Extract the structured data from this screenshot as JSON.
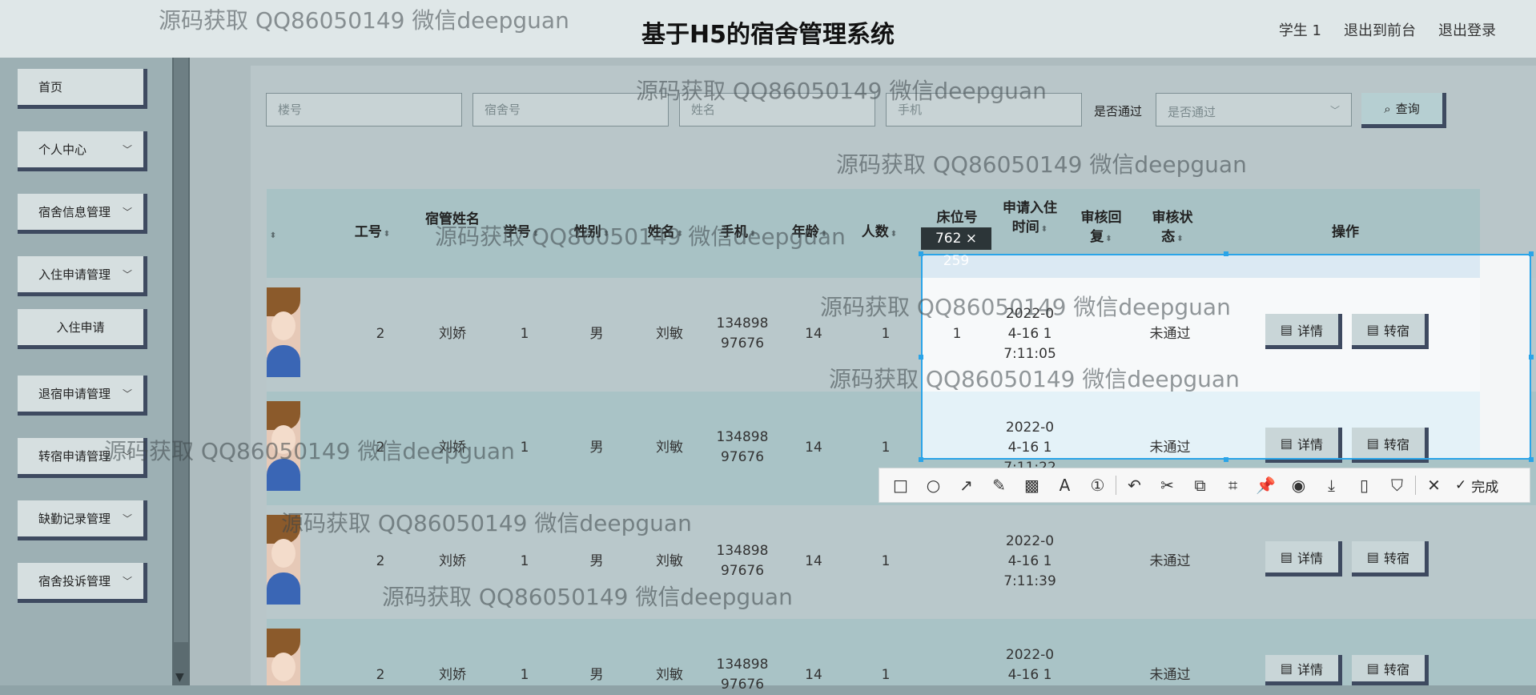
{
  "header": {
    "title": "基于H5的宿舍管理系统",
    "links": [
      "学生 1",
      "退出到前台",
      "退出登录"
    ]
  },
  "sidebar": {
    "items": [
      {
        "label": "首页",
        "has_chevron": false
      },
      {
        "label": "个人中心",
        "has_chevron": true
      },
      {
        "label": "宿舍信息管理",
        "has_chevron": true
      },
      {
        "label": "入住申请管理",
        "has_chevron": true
      },
      {
        "label": "入住申请",
        "has_chevron": false
      },
      {
        "label": "退宿申请管理",
        "has_chevron": true
      },
      {
        "label": "转宿申请管理",
        "has_chevron": true
      },
      {
        "label": "缺勤记录管理",
        "has_chevron": true
      },
      {
        "label": "宿舍投诉管理",
        "has_chevron": true
      }
    ]
  },
  "search": {
    "building_placeholder": "楼号",
    "room_placeholder": "宿舍号",
    "name_placeholder": "姓名",
    "phone_placeholder": "手机",
    "pass_label": "是否通过",
    "pass_placeholder": "是否通过",
    "query_label": "查询"
  },
  "table": {
    "columns": {
      "job_no": "工号",
      "manager_name": "宿管姓名",
      "student_no": "学号",
      "gender": "性别",
      "name": "姓名",
      "phone": "手机",
      "age": "年龄",
      "count": "人数",
      "bed_no": "床位号",
      "apply_time": "申请入住时间",
      "reply": "审核回复",
      "status": "审核状态",
      "actions": "操作"
    },
    "rows": [
      {
        "job_no": "2",
        "manager": "刘娇",
        "student_no": "1",
        "gender": "男",
        "name": "刘敏",
        "phone_1": "134898",
        "phone_2": "97676",
        "age": "14",
        "count": "1",
        "bed": "1",
        "time_1": "2022-0",
        "time_2": "4-16 1",
        "time_3": "7:11:05",
        "status": "未通过"
      },
      {
        "job_no": "2",
        "manager": "刘娇",
        "student_no": "1",
        "gender": "男",
        "name": "刘敏",
        "phone_1": "134898",
        "phone_2": "97676",
        "age": "14",
        "count": "1",
        "bed": "",
        "time_1": "2022-0",
        "time_2": "4-16 1",
        "time_3": "7:11:22",
        "status": "未通过"
      },
      {
        "job_no": "2",
        "manager": "刘娇",
        "student_no": "1",
        "gender": "男",
        "name": "刘敏",
        "phone_1": "134898",
        "phone_2": "97676",
        "age": "14",
        "count": "1",
        "bed": "",
        "time_1": "2022-0",
        "time_2": "4-16 1",
        "time_3": "7:11:39",
        "status": "未通过"
      },
      {
        "job_no": "2",
        "manager": "刘娇",
        "student_no": "1",
        "gender": "男",
        "name": "刘敏",
        "phone_1": "134898",
        "phone_2": "97676",
        "age": "14",
        "count": "1",
        "bed": "",
        "time_1": "2022-0",
        "time_2": "4-16 1",
        "time_3": "",
        "status": "未通过"
      }
    ],
    "detail_label": "详情",
    "transfer_label": "转宿"
  },
  "capture": {
    "size_label": "762 × 259",
    "done_label": "完成",
    "tools": [
      "rectangle-icon",
      "ellipse-icon",
      "arrow-icon",
      "pen-icon",
      "mosaic-icon",
      "text-icon",
      "number-icon",
      "undo-icon",
      "ocr-icon",
      "translate-icon",
      "long-capture-icon",
      "pin-icon",
      "record-icon",
      "download-icon",
      "phone-icon",
      "bookmark-icon",
      "close-icon"
    ]
  },
  "watermark": {
    "text": "源码获取 QQ86050149 微信deepguan"
  },
  "colors": {
    "header_bg": "#dfe7e8",
    "selection_border": "#2aa4e8",
    "button_shadow": "#3e4a60"
  }
}
